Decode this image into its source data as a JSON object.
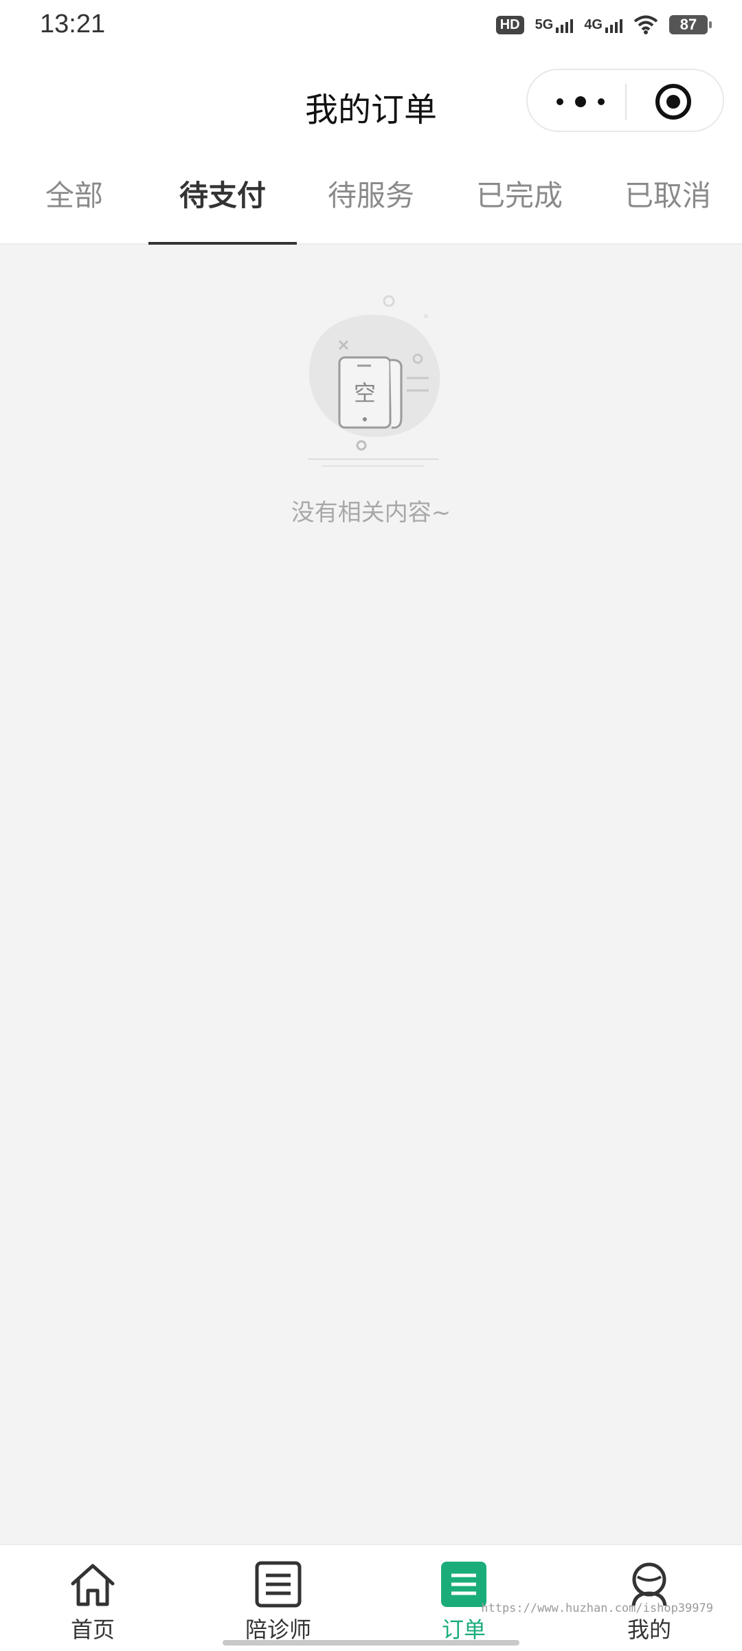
{
  "status_bar": {
    "time": "13:21",
    "hd": "HD",
    "net1": "5G",
    "net2": "4G",
    "battery": "87"
  },
  "header": {
    "title": "我的订单"
  },
  "tabs": [
    {
      "label": "全部",
      "active": false
    },
    {
      "label": "待支付",
      "active": true
    },
    {
      "label": "待服务",
      "active": false
    },
    {
      "label": "已完成",
      "active": false
    },
    {
      "label": "已取消",
      "active": false
    }
  ],
  "empty_state": {
    "icon_glyph": "空",
    "message": "没有相关内容~"
  },
  "tabbar": {
    "items": [
      {
        "label": "首页",
        "icon": "home-icon",
        "active": false
      },
      {
        "label": "陪诊师",
        "icon": "list-icon",
        "active": false
      },
      {
        "label": "订单",
        "icon": "order-icon",
        "active": true
      },
      {
        "label": "我的",
        "icon": "user-icon",
        "active": false
      }
    ],
    "active_color": "#1aad7a"
  },
  "watermark": "https://www.huzhan.com/ishop39979"
}
